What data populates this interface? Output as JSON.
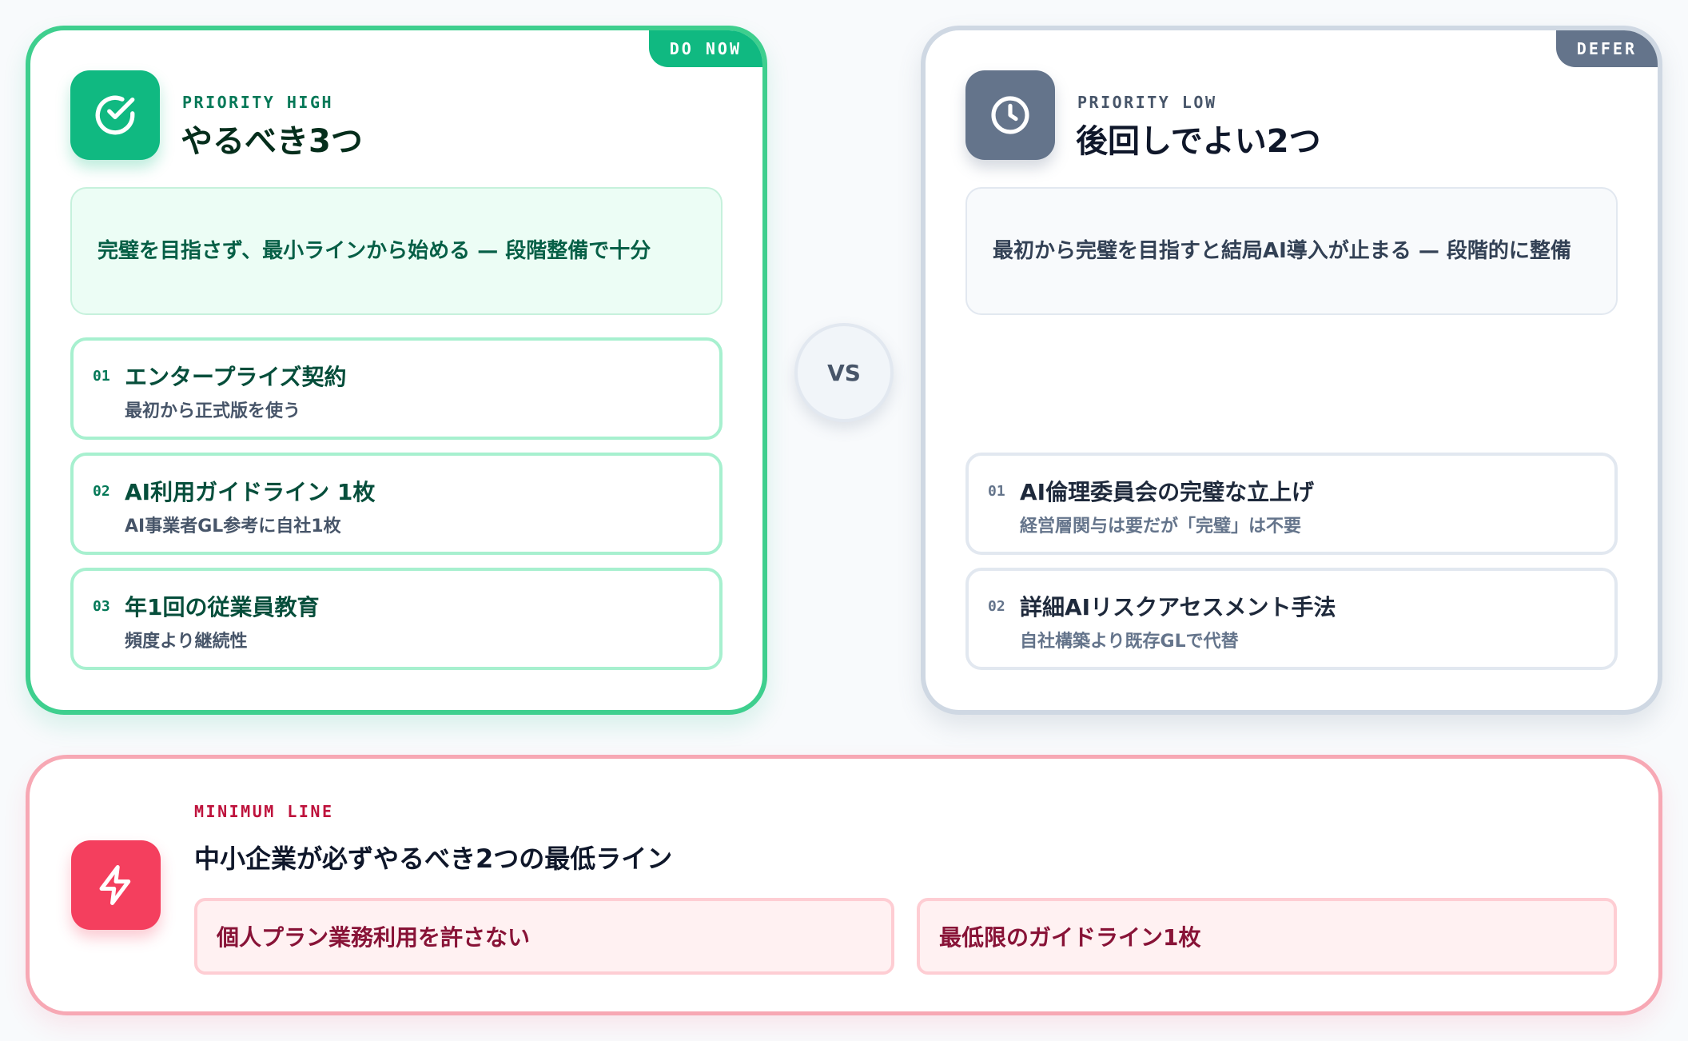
{
  "do_now": {
    "tag": "DO NOW",
    "eyebrow": "PRIORITY HIGH",
    "title": "やるべき3つ",
    "icon": "check-circle-icon",
    "summary": "完璧を目指さず、最小ラインから始める — 段階整備で十分",
    "items": [
      {
        "num": "01",
        "title": "エンタープライズ契約",
        "sub": "最初から正式版を使う"
      },
      {
        "num": "02",
        "title": "AI利用ガイドライン 1枚",
        "sub": "AI事業者GL参考に自社1枚"
      },
      {
        "num": "03",
        "title": "年1回の従業員教育",
        "sub": "頻度より継続性"
      }
    ],
    "accent": "#10b981"
  },
  "vs_label": "VS",
  "defer": {
    "tag": "DEFER",
    "eyebrow": "PRIORITY LOW",
    "title": "後回しでよい2つ",
    "icon": "clock-icon",
    "summary": "最初から完璧を目指すと結局AI導入が止まる — 段階的に整備",
    "items": [
      {
        "num": "01",
        "title": "AI倫理委員会の完璧な立上げ",
        "sub": "経営層関与は要だが「完璧」は不要"
      },
      {
        "num": "02",
        "title": "詳細AIリスクアセスメント手法",
        "sub": "自社構築より既存GLで代替"
      }
    ],
    "accent": "#64748b"
  },
  "minimum": {
    "eyebrow": "MINIMUM LINE",
    "title": "中小企業が必ずやるべき2つの最低ライン",
    "icon": "lightning-bolt-icon",
    "pills": [
      "個人プラン業務利用を許さない",
      "最低限のガイドライン1枚"
    ],
    "accent": "#f43f5e"
  }
}
